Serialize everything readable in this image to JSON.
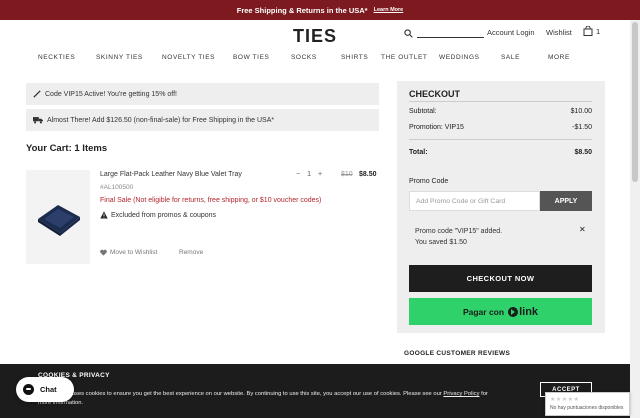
{
  "topbar": {
    "text": "Free Shipping & Returns in the USA*",
    "learn_more": "Learn More"
  },
  "header": {
    "logo": "TIES",
    "login": "Account Login",
    "wishlist": "Wishlist",
    "cart_count": "1"
  },
  "nav": [
    "NECKTIES",
    "SKINNY TIES",
    "NOVELTY TIES",
    "BOW TIES",
    "SOCKS",
    "SHIRTS",
    "THE OUTLET",
    "WEDDINGS",
    "SALE",
    "MORE"
  ],
  "banners": {
    "promo": "Code VIP15 Active! You're getting 15% off!",
    "shipping": "Almost There! Add $126.50 (non-final-sale) for Free Shipping in the USA*"
  },
  "cart": {
    "title": "Your Cart: 1 Items",
    "item": {
      "name": "Large Flat-Pack Leather Navy Blue Valet Tray",
      "sku": "#AL100500",
      "final_sale": "Final Sale (Not eligible for returns, free shipping, or $10 voucher codes)",
      "excluded": "Excluded from promos & coupons",
      "qty": "1",
      "minus": "−",
      "plus": "+",
      "price_old": "$10",
      "price_new": "$8.50",
      "move": "Move to Wishlist",
      "remove": "Remove"
    }
  },
  "checkout": {
    "title": "CHECKOUT",
    "subtotal_label": "Subtotal:",
    "subtotal": "$10.00",
    "promotion_label": "Promotion: VIP15",
    "promotion": "-$1.50",
    "total_label": "Total:",
    "total": "$8.50",
    "promo_label": "Promo Code",
    "promo_placeholder": "Add Promo Code or Gift Card",
    "apply": "APPLY",
    "promo_msg_1": "Promo code \"VIP15\" added.",
    "promo_msg_2": "You saved $1.50",
    "checkout_now": "CHECKOUT NOW",
    "pay_with": "Pagar con",
    "link": "link"
  },
  "google": "GOOGLE CUSTOMER REVIEWS",
  "cookies": {
    "title": "COOKIES & PRIVACY",
    "text": "This website uses cookies to ensure you get the best experience on our website. By continuing to use this site, you accept our use of cookies. Please see our",
    "policy": "Privacy Policy",
    "text_end": "for more information.",
    "accept": "ACCEPT"
  },
  "chat": {
    "label": "Chat"
  },
  "badge": {
    "text": "No hay puntuaciones disponibles"
  },
  "colors": {
    "topbar": "#7d1a1f",
    "final_sale": "#b3262d",
    "link_green": "#2fd26a"
  }
}
